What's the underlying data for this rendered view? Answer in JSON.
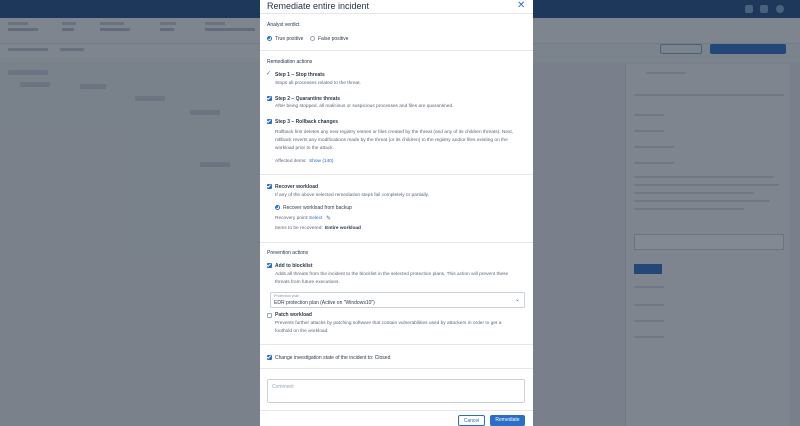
{
  "modal": {
    "title": "Remediate entire incident",
    "verdict": {
      "title": "Analyst verdict",
      "true_positive": "True positive",
      "false_positive": "False positive",
      "selected": "True positive"
    },
    "remediation": {
      "title": "Remediation actions",
      "step1_title": "Step 1 – Stop threats",
      "step1_desc": "Stops all processes related to the threat.",
      "step2_title": "Step 2 – Quarantine threats",
      "step2_desc": "After being stopped, all malicious or suspicious processes and files are quarantined.",
      "step3_title": "Step 3 – Rollback changes",
      "step3_desc_1": "Rollback first deletes any new registry entries or files created by the threat (and any of its children threats). Next,",
      "step3_desc_2": "rollback reverts any modifications made by the threat (or its children) to the registry and/or files existing on the",
      "step3_desc_3": "workload prior to the attack.",
      "affected_label": "Affected items:",
      "affected_link": "Show (140)"
    },
    "recover": {
      "title": "Recover workload",
      "desc": "If any of the above selected remediation steps fail completely or partially.",
      "option": "Recover workload from backup",
      "point_label": "Recovery point:",
      "point_link": "Select",
      "items_label": "Items to be recovered:",
      "items_value": "Entire workload"
    },
    "prevention": {
      "title": "Prevention actions",
      "blocklist_title": "Add to blocklist",
      "blocklist_desc_1": "Adds all threats from the incident to the blocklist in the selected protection plans. This action will prevent these",
      "blocklist_desc_2": "threats from future executions.",
      "plan_label": "Protection plan",
      "plan_value": "EDR protection plan (Active on \"Windows10\")",
      "patch_title": "Patch workload",
      "patch_desc_1": "Prevents further attacks by patching software that contain vulnerabilities used by attackers in order to get a",
      "patch_desc_2": "foothold on the workload."
    },
    "investigation": "Change investigation state of the incident to: Closed",
    "comment_placeholder": "Comment",
    "cancel": "Cancel",
    "remediate": "Remediate"
  },
  "colors": {
    "accent": "#2b6fc5",
    "overlay": "rgba(30,40,55,.55)"
  }
}
